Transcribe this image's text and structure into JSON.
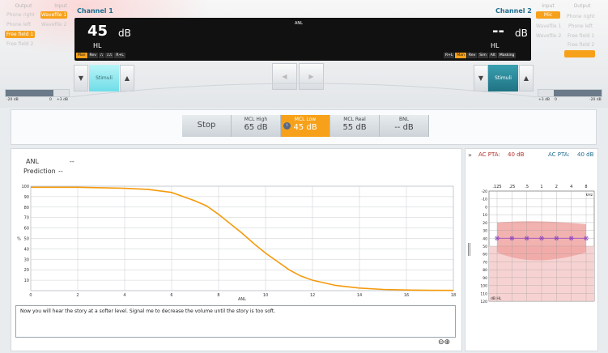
{
  "left": {
    "output_label": "Output",
    "input_label": "Input",
    "outputs": [
      "Phone right",
      "Phone left",
      "Free field 1",
      "Free field 2"
    ],
    "inputs": [
      "Wavefile 1",
      "Wavefile 2"
    ],
    "selected_output": "Free field 1",
    "selected_input": "Wavefile 1"
  },
  "right": {
    "input_label": "Input",
    "output_label": "Output",
    "inputs": [
      "Mic",
      "Wavefile 1",
      "Wavefile 2"
    ],
    "outputs": [
      "Phone right",
      "Phone left",
      "Free field 1",
      "Free field 2"
    ],
    "selected_input": "Mic"
  },
  "ch1": {
    "title": "Channel 1",
    "level": "45",
    "unit": "dB",
    "hl": "HL",
    "modes": [
      "Man",
      "Rev",
      "⎍",
      "⎍⎍",
      "R+L"
    ],
    "stimuli": "Stimuli",
    "slider_left": "-20 dB",
    "slider_mid": "0",
    "slider_right": "+3 dB"
  },
  "ch2": {
    "title": "Channel 2",
    "level": "--",
    "unit": "dB",
    "hl": "HL",
    "modes": [
      "R+L",
      "Man",
      "Rev",
      "Sim",
      "Alt",
      "Masking"
    ],
    "stimuli": "Stimuli",
    "slider_left": "+3 dB",
    "slider_mid": "0",
    "slider_right": "-20 dB"
  },
  "display_title": "ANL",
  "measure": {
    "stop": "Stop",
    "buttons": [
      {
        "label": "MCL High",
        "value": "65 dB"
      },
      {
        "label": "MCL Low",
        "value": "45 dB"
      },
      {
        "label": "MCL Real",
        "value": "55 dB"
      },
      {
        "label": "BNL",
        "value": "-- dB"
      }
    ]
  },
  "results": {
    "anl_label": "ANL",
    "anl_value": "--",
    "prediction_label": "Prediction",
    "prediction_value": "--"
  },
  "chart_data": {
    "type": "line",
    "xlabel": "ANL",
    "ylabel": "%",
    "xlim": [
      0,
      18
    ],
    "ylim": [
      0,
      100
    ],
    "xticks": [
      0,
      2,
      4,
      6,
      8,
      10,
      12,
      14,
      16,
      18
    ],
    "yticks": [
      10,
      20,
      30,
      40,
      50,
      60,
      70,
      80,
      90,
      100
    ],
    "series": [
      {
        "color": "#f59a0c",
        "x": [
          0,
          1,
          2,
          3,
          4,
          5,
          6,
          7,
          7.5,
          8,
          8.5,
          9,
          9.5,
          10,
          10.5,
          11,
          11.5,
          12,
          13,
          14,
          15,
          16,
          17,
          18
        ],
        "y": [
          99,
          99,
          99,
          98.5,
          98,
          97,
          94,
          86,
          81,
          73,
          64,
          55,
          45,
          36,
          28,
          20,
          14,
          10,
          5,
          2.5,
          1.2,
          0.6,
          0.3,
          0.2
        ]
      }
    ]
  },
  "instruction": "Now you will hear the story at a softer level. Signal me to decrease the volume until the story is too soft.",
  "audiogram": {
    "ac_pta_left_label": "AC PTA:",
    "ac_pta_left_value": "40 dB",
    "ac_pta_right_label": "AC PTA:",
    "ac_pta_right_value": "40 dB",
    "freq_labels": [
      ".125",
      ".25",
      ".5",
      "1",
      "2",
      "4",
      "8"
    ],
    "khz": "kHz",
    "db_labels": [
      "-20",
      "-10",
      "0",
      "10",
      "20",
      "30",
      "40",
      "50",
      "60",
      "70",
      "80",
      "90",
      "100",
      "110",
      "120"
    ],
    "db_hl": "dB HL",
    "threshold_db": 40
  },
  "colors": {
    "accent": "#f7a11a",
    "channel": "#1f6d8e",
    "stimuli1": "#8ee8f0",
    "stimuli2": "#2a8a9c",
    "curve": "#f59a0c",
    "pta_left": "#b0302c",
    "pta_right": "#1f6d8e",
    "marker": "#8a3fc0"
  }
}
